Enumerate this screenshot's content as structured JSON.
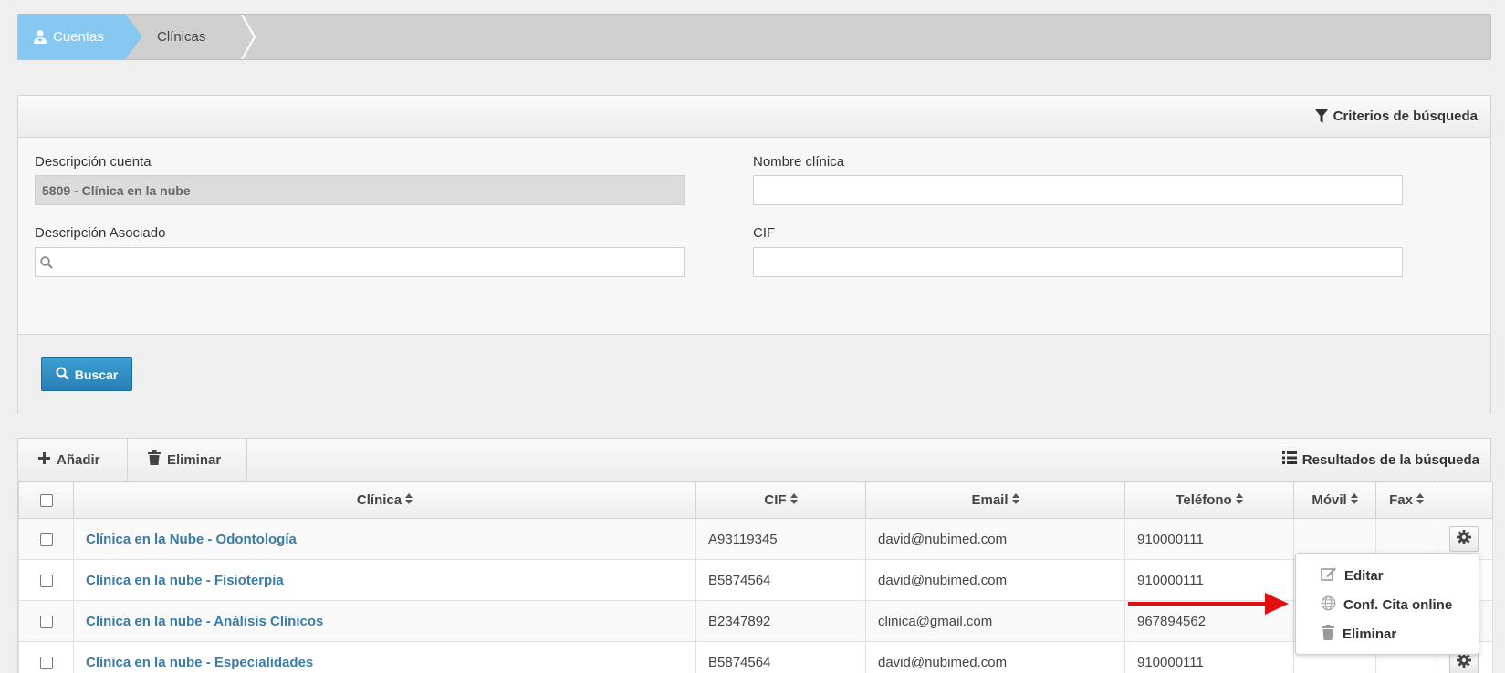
{
  "breadcrumb": {
    "items": [
      {
        "label": "Cuentas",
        "icon": "user-doctor-icon",
        "active": true
      },
      {
        "label": "Clínicas",
        "active": false
      }
    ],
    "active_color": "#86c8ef"
  },
  "search_panel": {
    "title": "Criterios de búsqueda",
    "fields": {
      "descripcion_cuenta": {
        "label": "Descripción cuenta",
        "value": "5809 - Clínica en la nube"
      },
      "nombre_clinica": {
        "label": "Nombre clínica",
        "value": ""
      },
      "descripcion_asociado": {
        "label": "Descripción Asociado",
        "value": ""
      },
      "cif": {
        "label": "CIF",
        "value": ""
      }
    },
    "search_button": "Buscar"
  },
  "results": {
    "toolbar": {
      "add_label": "Añadir",
      "delete_label": "Eliminar",
      "title": "Resultados de la búsqueda"
    },
    "columns": [
      "Clínica",
      "CIF",
      "Email",
      "Teléfono",
      "Móvil",
      "Fax"
    ],
    "rows": [
      {
        "clinica": "Clínica en la Nube - Odontología",
        "cif": "A93119345",
        "email": "david@nubimed.com",
        "telefono": "910000111",
        "movil": "",
        "fax": ""
      },
      {
        "clinica": "Clínica en la nube - Fisioterpia",
        "cif": "B5874564",
        "email": "david@nubimed.com",
        "telefono": "910000111",
        "movil": "",
        "fax": ""
      },
      {
        "clinica": "Clinica en la nube - Análisis Clínicos",
        "cif": "B2347892",
        "email": "clinica@gmail.com",
        "telefono": "967894562",
        "movil": "",
        "fax": ""
      },
      {
        "clinica": "Clínica en la nube - Especialidades",
        "cif": "B5874564",
        "email": "david@nubimed.com",
        "telefono": "910000111",
        "movil": "",
        "fax": ""
      }
    ]
  },
  "dropdown_menu": {
    "items": [
      {
        "label": "Editar",
        "icon": "edit-icon"
      },
      {
        "label": "Conf. Cita online",
        "icon": "globe-icon"
      },
      {
        "label": "Eliminar",
        "icon": "trash-icon"
      }
    ]
  },
  "colors": {
    "primary_button": "#2a8fc4",
    "link": "#3a7ca5",
    "annotation_arrow": "#e01010"
  }
}
